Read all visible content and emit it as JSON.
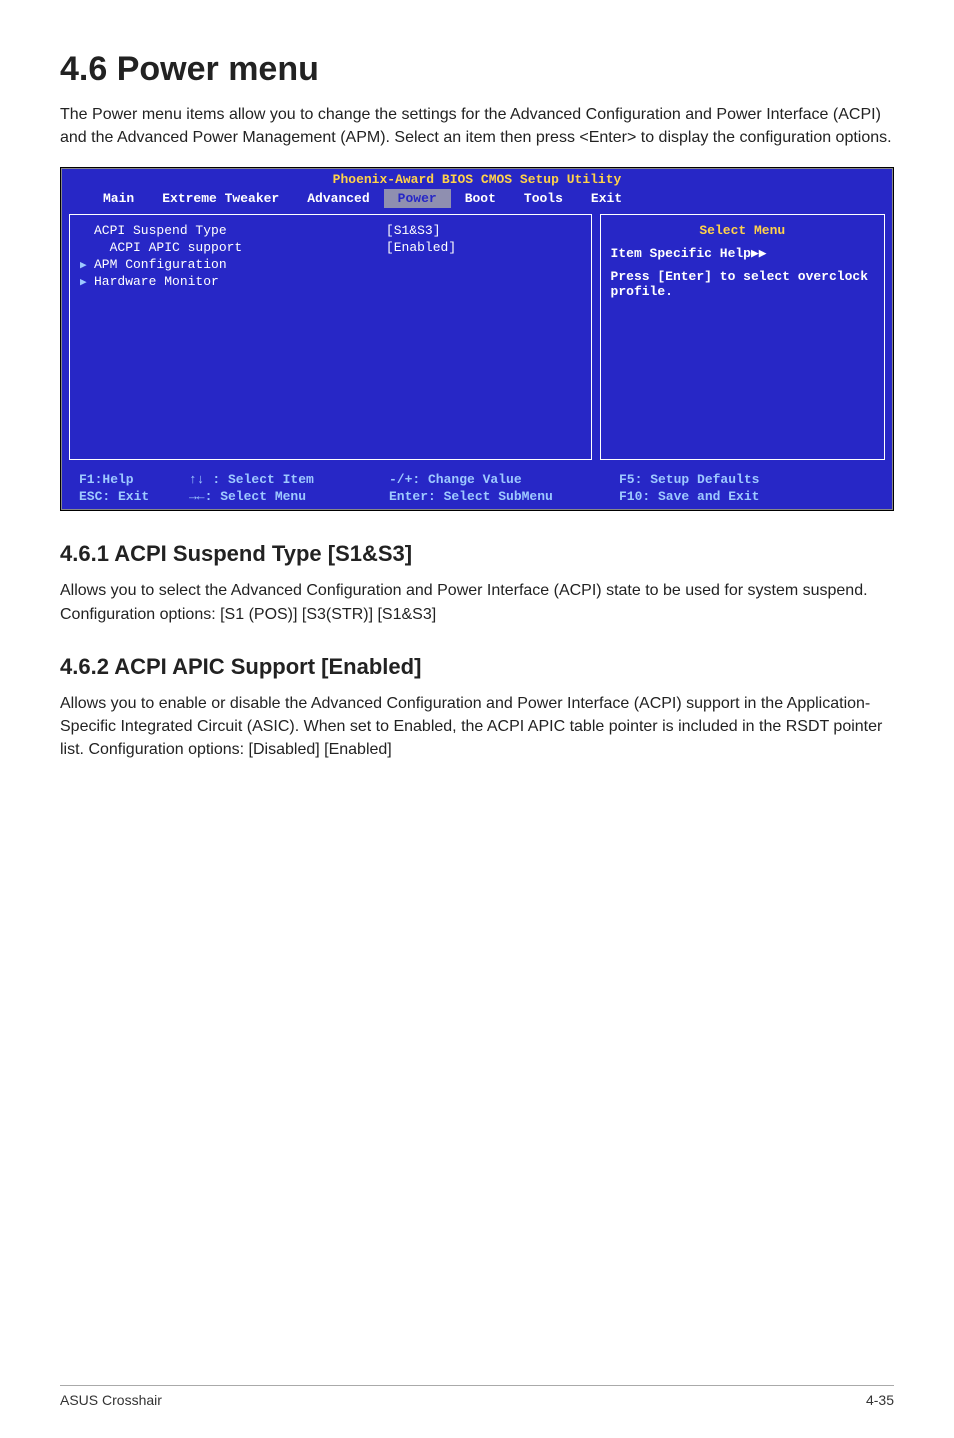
{
  "page": {
    "title": "4.6    Power menu",
    "intro": "The Power menu items allow you to change the settings for the Advanced Configuration and Power Interface (ACPI) and the Advanced Power Management (APM). Select an item then press <Enter> to display the configuration options."
  },
  "bios": {
    "header": "Phoenix-Award BIOS CMOS Setup Utility",
    "tabs": [
      "Main",
      "Extreme Tweaker",
      "Advanced",
      "Power",
      "Boot",
      "Tools",
      "Exit"
    ],
    "active_tab": "Power",
    "rows": [
      {
        "arrow": "",
        "label": "ACPI Suspend Type",
        "value": "[S1&S3]"
      },
      {
        "arrow": "",
        "label": "  ACPI APIC support",
        "value": "[Enabled]"
      },
      {
        "arrow": "▶",
        "label": "APM Configuration",
        "value": ""
      },
      {
        "arrow": "▶",
        "label": "Hardware Monitor",
        "value": ""
      }
    ],
    "help": {
      "title": "Select Menu",
      "item_specific": "Item Specific Help▶▶",
      "body": "Press [Enter] to select overclock profile."
    },
    "footer": {
      "c1a": "F1:Help",
      "c1b": "ESC: Exit",
      "c2a": "↑↓ : Select Item",
      "c2b": "→←: Select Menu",
      "c3a": "-/+: Change Value",
      "c3b": "Enter: Select SubMenu",
      "c4a": "F5: Setup Defaults",
      "c4b": "F10: Save and Exit"
    }
  },
  "sections": [
    {
      "heading": "4.6.1    ACPI Suspend Type [S1&S3]",
      "text": "Allows you to select the Advanced Configuration and Power Interface (ACPI) state to be used for system suspend. Configuration options: [S1 (POS)] [S3(STR)] [S1&S3]"
    },
    {
      "heading": "4.6.2    ACPI APIC Support [Enabled]",
      "text": "Allows you to enable or disable the Advanced Configuration and Power Interface (ACPI) support in the Application-Specific Integrated Circuit (ASIC). When set to Enabled, the ACPI APIC table pointer is included in the RSDT pointer list. Configuration options: [Disabled] [Enabled]"
    }
  ],
  "footer": {
    "left": "ASUS Crosshair",
    "right": "4-35"
  }
}
